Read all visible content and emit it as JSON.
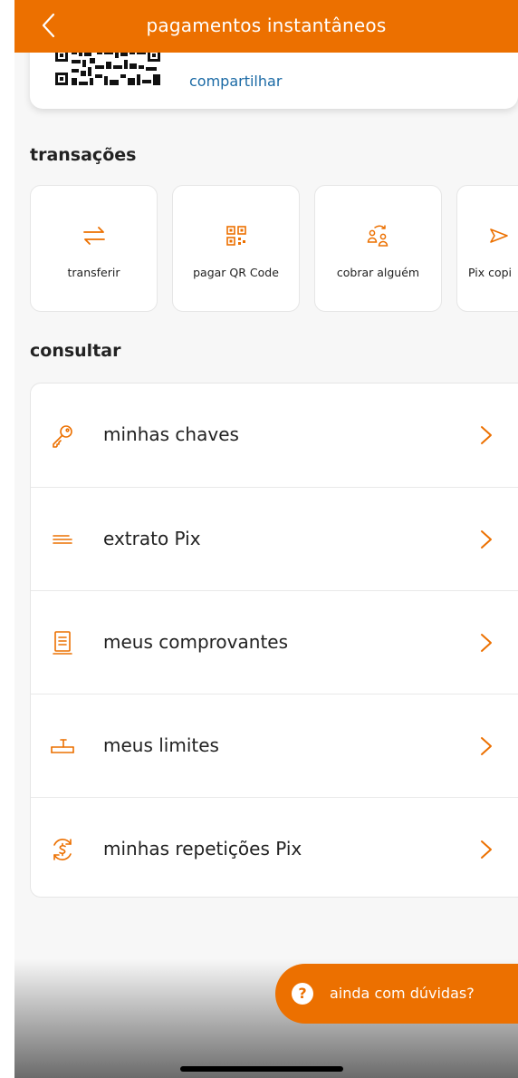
{
  "header": {
    "title": "pagamentos instantâneos",
    "back_glyph": "‹"
  },
  "qr_card": {
    "key_text": "··· ··· ···-·—",
    "share_label": "compartilhar"
  },
  "sections": {
    "transactions_title": "transações",
    "consult_title": "consultar"
  },
  "transactions": [
    {
      "label": "transferir",
      "icon": "transfer-arrows-icon"
    },
    {
      "label": "pagar QR Code",
      "icon": "qr-code-icon"
    },
    {
      "label": "cobrar alguém",
      "icon": "request-people-icon"
    },
    {
      "label": "Pix copi",
      "icon": "copy-paste-icon"
    }
  ],
  "consult_items": [
    {
      "label": "minhas chaves",
      "icon": "key-icon"
    },
    {
      "label": "extrato Pix",
      "icon": "statement-lines-icon"
    },
    {
      "label": "meus comprovantes",
      "icon": "receipt-icon"
    },
    {
      "label": "meus limites",
      "icon": "limit-slider-icon"
    },
    {
      "label": "minhas repetições Pix",
      "icon": "recurring-money-icon"
    }
  ],
  "help": {
    "label": "ainda com dúvidas?",
    "icon_glyph": "?"
  },
  "colors": {
    "accent": "#ec7000",
    "link": "#1b6aa5"
  }
}
